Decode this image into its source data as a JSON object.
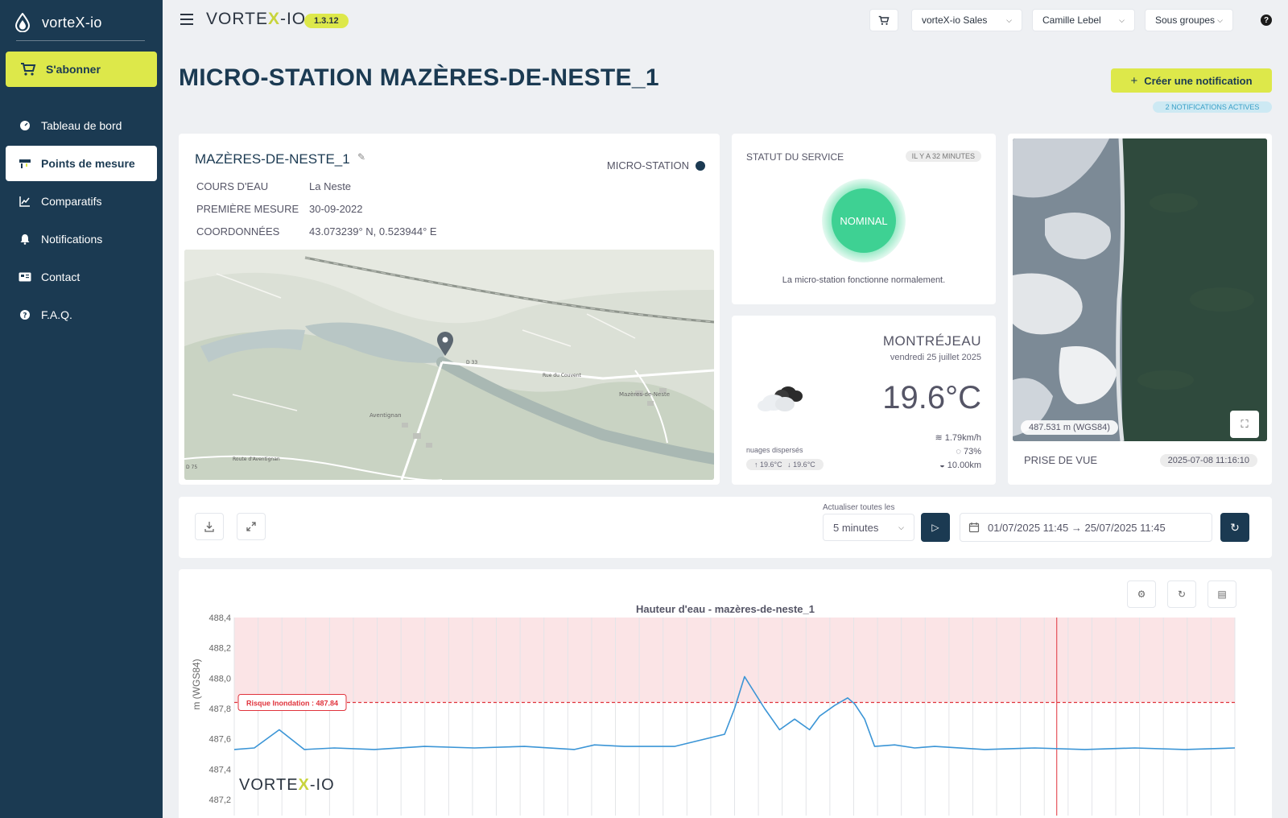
{
  "brand": {
    "name": "vorteX-io"
  },
  "sidebar": {
    "subscribe_label": "S'abonner",
    "items": [
      {
        "label": "Tableau de bord",
        "icon": "dashboard-icon"
      },
      {
        "label": "Points de mesure",
        "icon": "measure-point-icon",
        "active": true
      },
      {
        "label": "Comparatifs",
        "icon": "chart-icon"
      },
      {
        "label": "Notifications",
        "icon": "bell-icon"
      },
      {
        "label": "Contact",
        "icon": "contact-card-icon"
      },
      {
        "label": "F.A.Q.",
        "icon": "help-icon"
      }
    ]
  },
  "topbar": {
    "logo_text_a": "VORTE",
    "logo_text_x": "X",
    "logo_text_b": "-IO",
    "version": "1.3.12",
    "org_select": "vorteX-io Sales",
    "user_select": "Camille Lebel",
    "groups_select": "Sous groupes",
    "help": "?"
  },
  "page": {
    "title": "MICRO-STATION MAZÈRES-DE-NESTE_1",
    "create_notification": "Créer une notification",
    "active_notifications": "2 NOTIFICATIONS ACTIVES"
  },
  "station": {
    "name": "MAZÈRES-DE-NESTE_1",
    "type": "MICRO-STATION",
    "fields": [
      {
        "key": "COURS D'EAU",
        "value": "La Neste"
      },
      {
        "key": "PREMIÈRE MESURE",
        "value": "30-09-2022"
      },
      {
        "key": "COORDONNÉES",
        "value": "43.073239° N, 0.523944° E"
      }
    ],
    "map_labels": {
      "road1": "D 33",
      "road2": "Rue du Couvent",
      "village1": "Aventignan",
      "village2": "Mazères-de-Neste",
      "road3": "Route d'Aventignan",
      "road4": "D 75"
    }
  },
  "status": {
    "label": "STATUT DU SERVICE",
    "time": "IL Y A 32 MINUTES",
    "state": "NOMINAL",
    "message": "La micro-station fonctionne normalement.",
    "color": "#3ed193"
  },
  "weather": {
    "city": "MONTRÉJEAU",
    "date": "vendredi 25 juillet 2025",
    "temperature": "19.6°C",
    "description": "nuages dispersés",
    "max": "19.6°C",
    "min": "19.6°C",
    "wind": "1.79km/h",
    "humidity": "73%",
    "visibility": "10.00km"
  },
  "photo": {
    "overlay": "487.531 m (WGS84)",
    "label": "PRISE DE VUE",
    "date": "2025-07-08 11:16:10"
  },
  "controls": {
    "refresh_label": "Actualiser toutes les",
    "refresh_value": "5 minutes",
    "date_range": "01/07/2025 11:45 → 25/07/2025 11:45"
  },
  "chart_data": {
    "type": "line",
    "title": "Hauteur d'eau - mazères-de-neste_1",
    "ylabel": "m (WGS84)",
    "y_ticks": [
      "488,4",
      "488,2",
      "488,0",
      "487,8",
      "487,6",
      "487,4",
      "487,2"
    ],
    "ylim": [
      487.2,
      488.4
    ],
    "threshold": {
      "label": "Risque Inondation : 487.84",
      "value": 487.84,
      "color": "#e0333c"
    },
    "series": [
      {
        "color": "#3b95d6",
        "x": [
          0,
          0.02,
          0.045,
          0.07,
          0.1,
          0.14,
          0.19,
          0.24,
          0.29,
          0.34,
          0.36,
          0.39,
          0.44,
          0.49,
          0.5,
          0.51,
          0.53,
          0.545,
          0.56,
          0.575,
          0.585,
          0.6,
          0.613,
          0.62,
          0.63,
          0.64,
          0.66,
          0.68,
          0.7,
          0.75,
          0.8,
          0.85,
          0.9,
          0.95,
          1.0
        ],
        "values": [
          487.53,
          487.54,
          487.66,
          487.53,
          487.54,
          487.53,
          487.55,
          487.54,
          487.55,
          487.53,
          487.56,
          487.55,
          487.55,
          487.63,
          487.8,
          488.01,
          487.8,
          487.66,
          487.73,
          487.66,
          487.75,
          487.82,
          487.87,
          487.83,
          487.73,
          487.55,
          487.56,
          487.54,
          487.55,
          487.53,
          487.54,
          487.53,
          487.54,
          487.53,
          487.54
        ]
      }
    ],
    "marker_x": 0.822
  },
  "chart_logo": {
    "text_a": "VORTE",
    "text_x": "X",
    "text_b": "-IO"
  }
}
